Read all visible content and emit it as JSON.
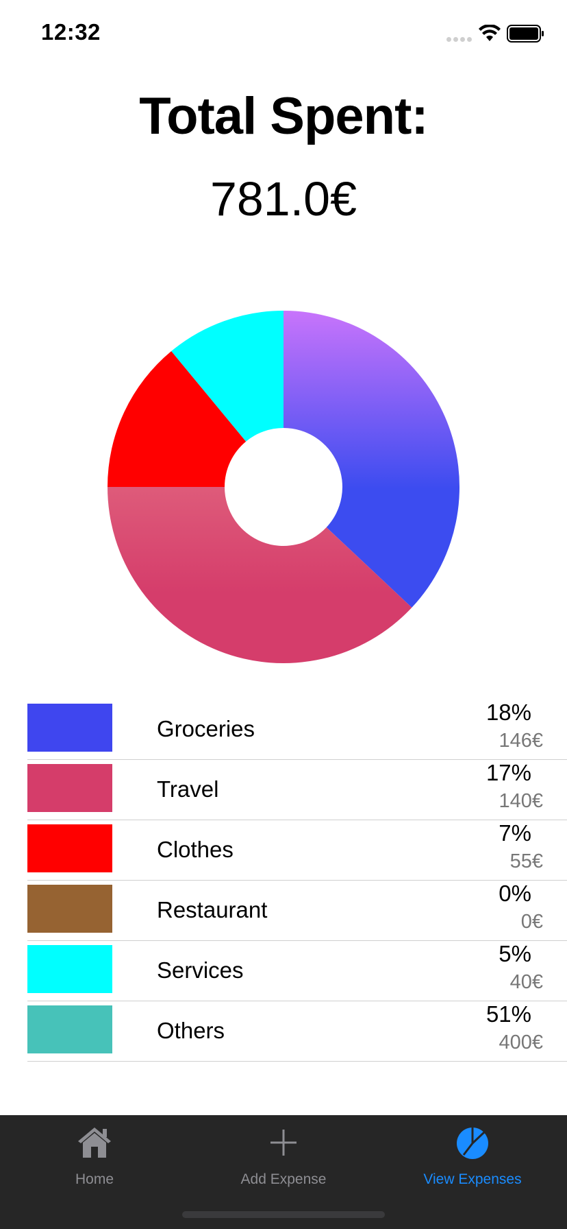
{
  "status_bar": {
    "time": "12:32",
    "signal_icon": "cellular-signal-dots",
    "wifi_icon": "wifi-icon",
    "battery_icon": "battery-full-icon"
  },
  "header": {
    "title": "Total Spent:",
    "amount": "781.0€"
  },
  "chart_data": {
    "type": "pie",
    "donut": true,
    "slices": [
      {
        "label": "Groceries",
        "percent_of_circle": 37,
        "color": "#3c4cf0",
        "gradient_top": "#c874fb"
      },
      {
        "label": "Travel",
        "percent_of_circle": 38,
        "color": "#d53d6b",
        "gradient_top": "#de5b7a"
      },
      {
        "label": "Clothes",
        "percent_of_circle": 14,
        "color": "#ff0000"
      },
      {
        "label": "Services",
        "percent_of_circle": 11,
        "color": "#00ffff"
      }
    ]
  },
  "legend": {
    "items": [
      {
        "label": "Groceries",
        "percent": "18%",
        "amount": "146€",
        "color": "#3f46ef"
      },
      {
        "label": "Travel",
        "percent": "17%",
        "amount": "140€",
        "color": "#d53d6a"
      },
      {
        "label": "Clothes",
        "percent": "7%",
        "amount": "55€",
        "color": "#ff0000"
      },
      {
        "label": "Restaurant",
        "percent": "0%",
        "amount": "0€",
        "color": "#966332"
      },
      {
        "label": "Services",
        "percent": "5%",
        "amount": "40€",
        "color": "#00ffff"
      },
      {
        "label": "Others",
        "percent": "51%",
        "amount": "400€",
        "color": "#47c2b9"
      }
    ]
  },
  "tab_bar": {
    "tabs": [
      {
        "label": "Home",
        "icon": "home-icon",
        "active": false
      },
      {
        "label": "Add Expense",
        "icon": "plus-icon",
        "active": false
      },
      {
        "label": "View Expenses",
        "icon": "pie-chart-icon",
        "active": true
      }
    ],
    "active_color": "#1a8cff",
    "inactive_color": "#8e8e93"
  }
}
